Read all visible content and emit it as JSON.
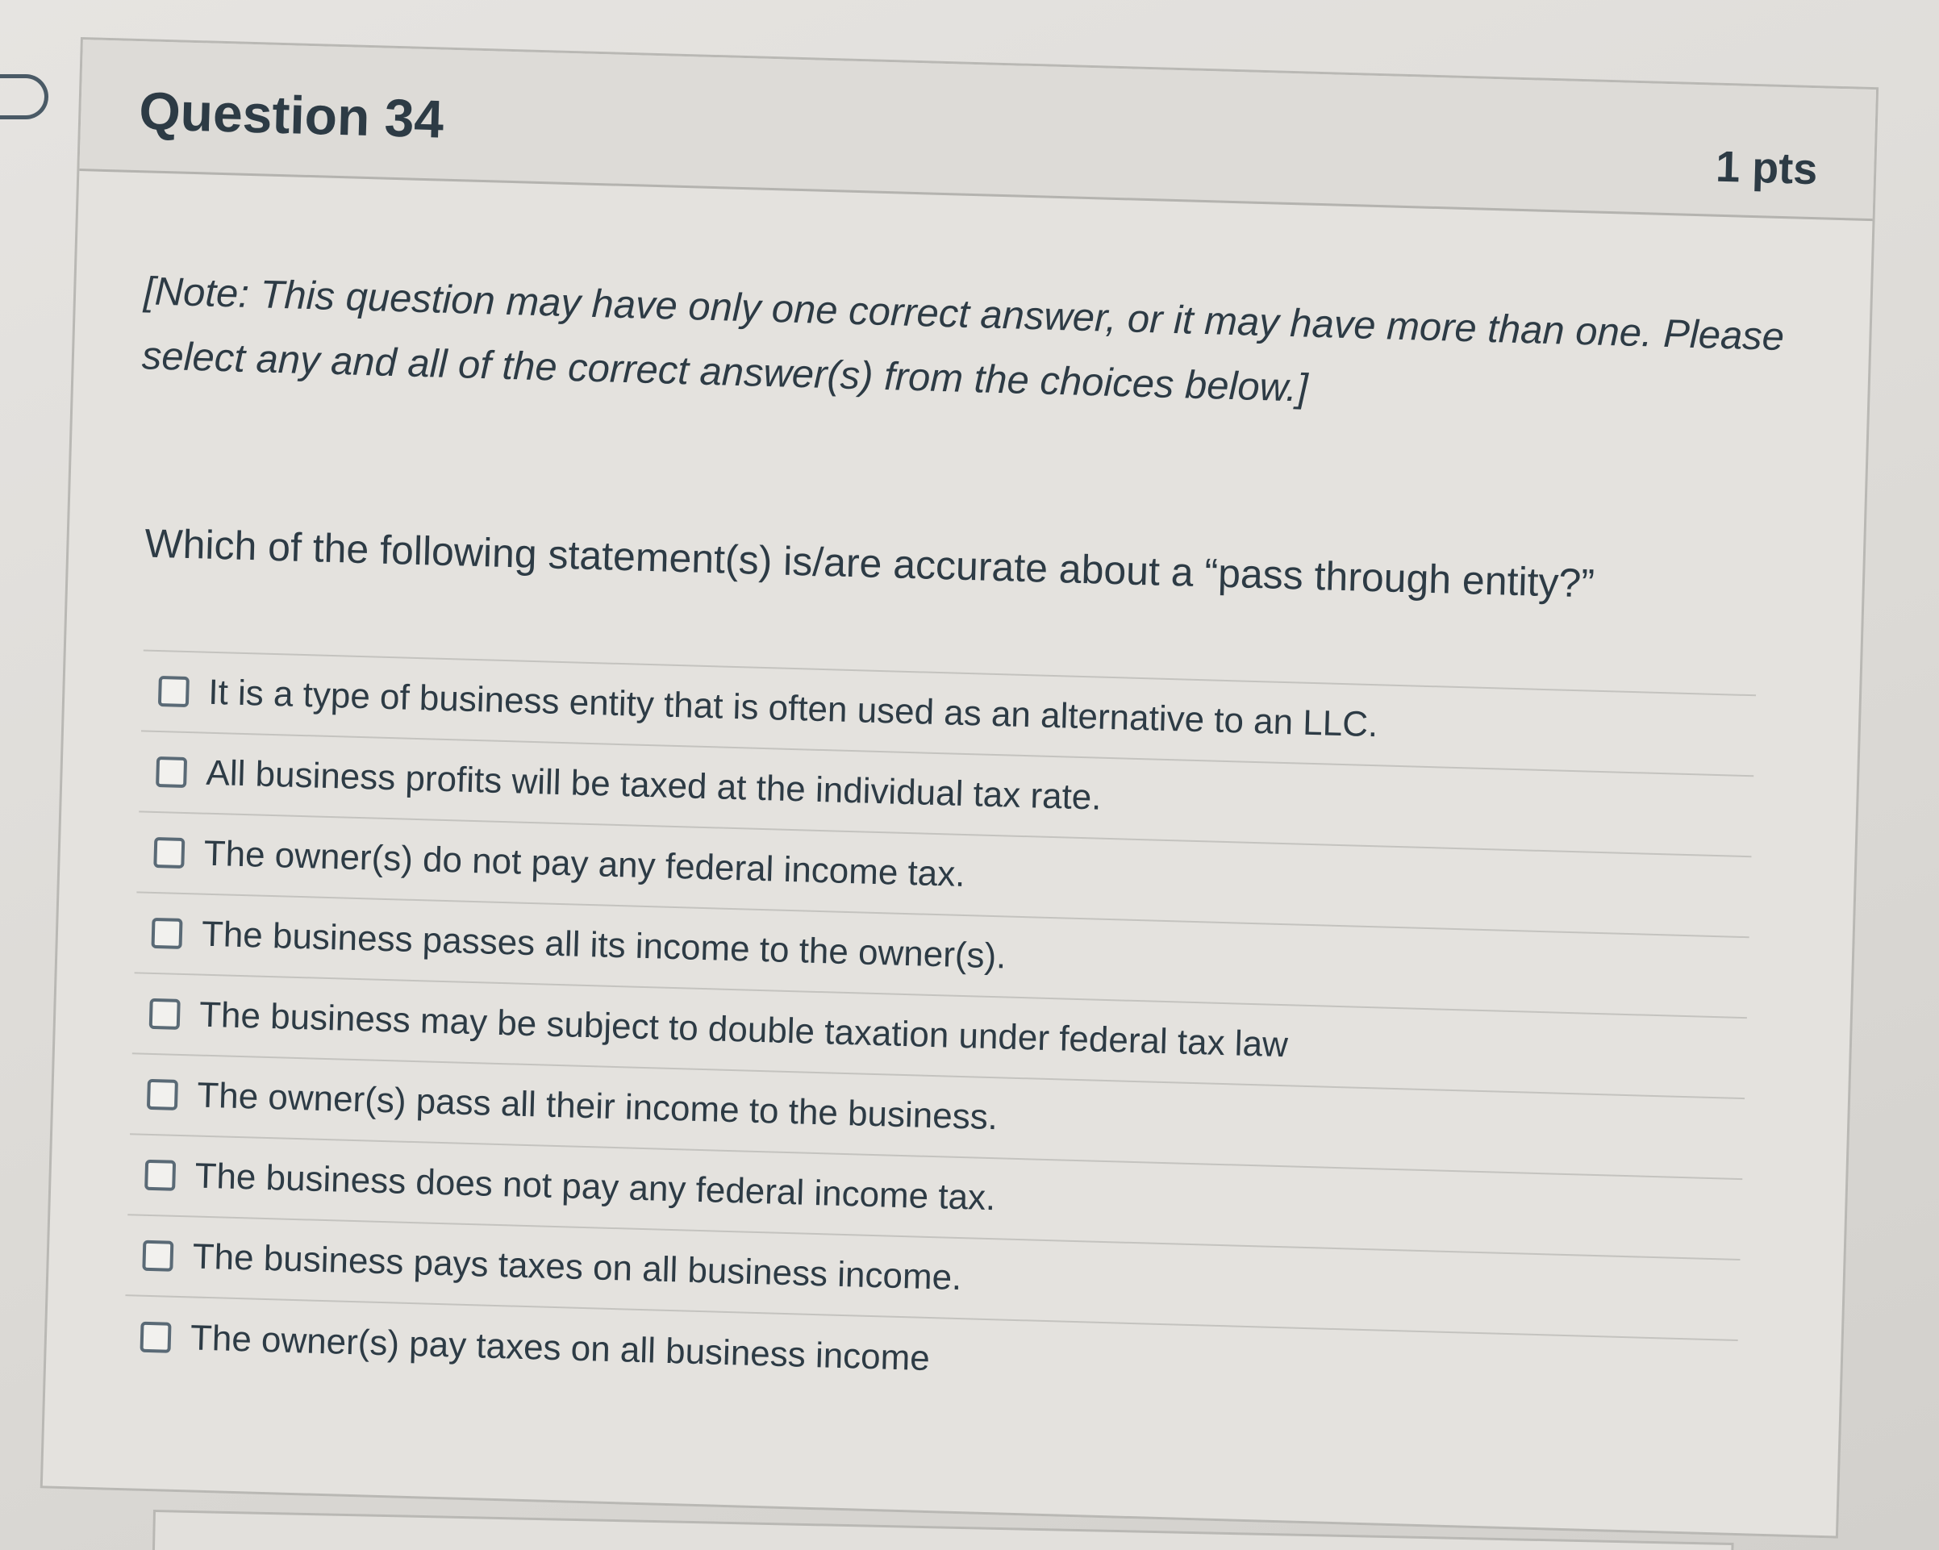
{
  "question": {
    "title": "Question 34",
    "points": "1 pts",
    "note": "[Note: This question may have only one correct answer, or it may have more than one. Please select any and all of the correct answer(s) from the choices below.]",
    "prompt": "Which of the following statement(s) is/are accurate about  a “pass through entity?”",
    "answers": [
      {
        "label": "It is a type of business entity that is often used as an alternative to an LLC.",
        "checked": false
      },
      {
        "label": "All business profits will be taxed at the individual tax rate.",
        "checked": false
      },
      {
        "label": "The owner(s) do not pay any federal income tax.",
        "checked": false
      },
      {
        "label": "The business passes all its income to the owner(s).",
        "checked": false
      },
      {
        "label": "The business may be subject to double taxation under federal tax law",
        "checked": false
      },
      {
        "label": "The owner(s) pass all their income to the business.",
        "checked": false
      },
      {
        "label": "The business does not pay any federal income tax.",
        "checked": false
      },
      {
        "label": "The business pays taxes on all business income.",
        "checked": false
      },
      {
        "label": "The owner(s) pay taxes on all business income",
        "checked": false
      }
    ]
  },
  "icons": {
    "bookmark": "bookmark-flag-icon",
    "checkbox": "checkbox-icon"
  },
  "colors": {
    "text": "#2d3b45",
    "card_background": "#e4e2de",
    "border": "#b9b8b4"
  }
}
